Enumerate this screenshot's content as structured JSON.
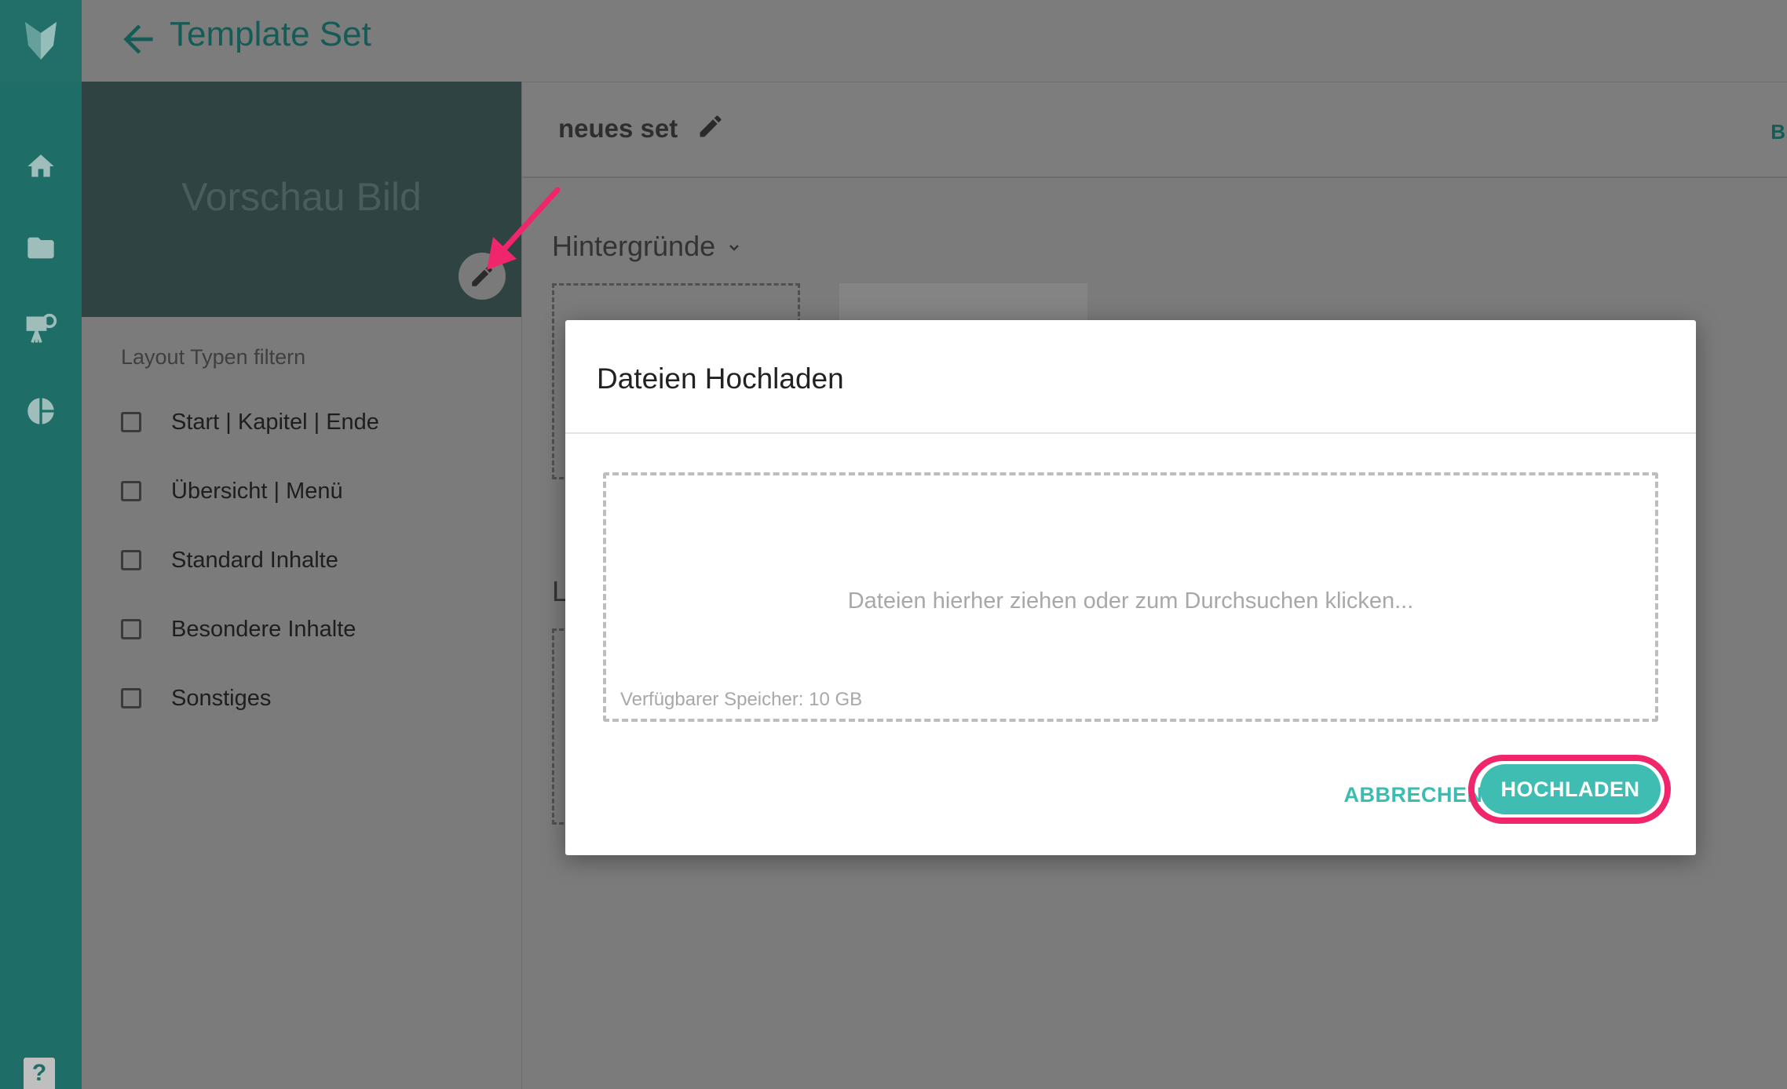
{
  "header": {
    "title": "Template Set"
  },
  "preview": {
    "label": "Vorschau Bild"
  },
  "filters": {
    "title": "Layout Typen filtern",
    "items": [
      {
        "label": "Start | Kapitel | Ende",
        "checked": false
      },
      {
        "label": "Übersicht | Menü",
        "checked": false
      },
      {
        "label": "Standard Inhalte",
        "checked": false
      },
      {
        "label": "Besondere Inhalte",
        "checked": false
      },
      {
        "label": "Sonstiges",
        "checked": false
      }
    ]
  },
  "set": {
    "name": "neues set",
    "right_action_partial": "B"
  },
  "sections": {
    "backgrounds_title": "Hintergründe",
    "second_partial": "L"
  },
  "modal": {
    "title": "Dateien Hochladen",
    "dropzone_text": "Dateien hierher ziehen oder zum Durchsuchen klicken...",
    "storage_text": "Verfügbarer Speicher: 10 GB",
    "cancel_label": "ABBRECHEN",
    "upload_label": "HOCHLADEN"
  },
  "icons": {
    "logo": "fox-logo-icon",
    "back": "arrow-left-icon",
    "home": "home-icon",
    "folder": "folder-icon",
    "presentation": "presentation-icon",
    "chart": "pie-chart-icon",
    "help": "help-icon",
    "edit": "pencil-icon",
    "chevron": "chevron-down-icon"
  },
  "colors": {
    "rail": "#1f6d67",
    "accent": "#3fbdb3",
    "highlight": "#f0256b"
  },
  "help_label": "?"
}
